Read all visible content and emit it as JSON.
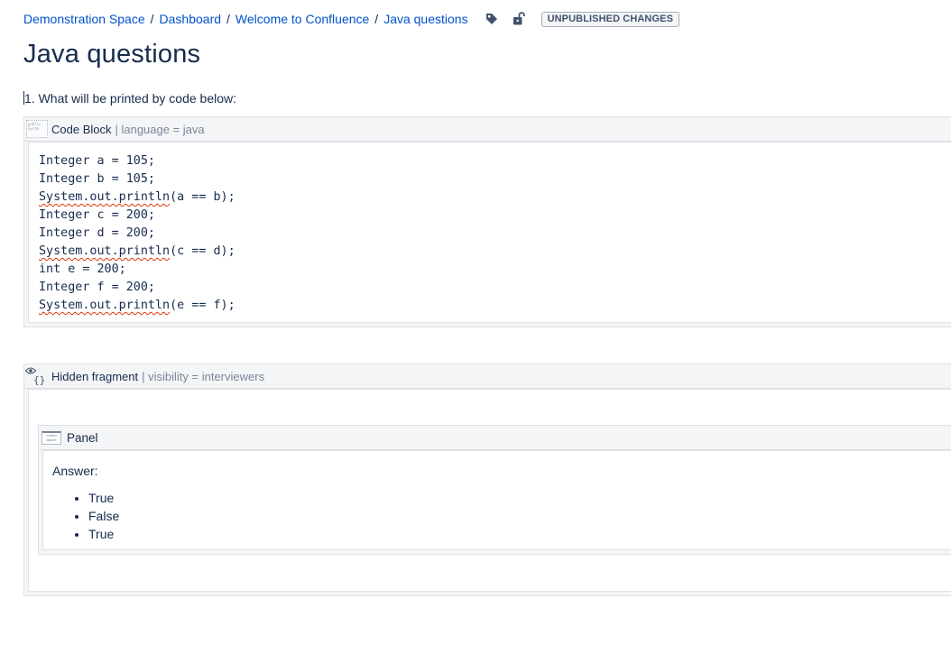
{
  "breadcrumb": {
    "items": [
      "Demonstration Space",
      "Dashboard",
      "Welcome to Confluence",
      "Java questions"
    ],
    "separator": "/",
    "status_badge": "UNPUBLISHED CHANGES"
  },
  "page": {
    "title": "Java questions",
    "question": "1. What will be printed by code below:"
  },
  "code_block": {
    "title": "Code Block",
    "param": "| language = java",
    "lines": [
      "Integer a = 105;",
      "Integer b = 105;",
      "System.out.println(a == b);",
      "Integer c = 200;",
      "Integer d = 200;",
      "System.out.println(c == d);",
      "int e = 200;",
      "Integer f = 200;",
      "System.out.println(e == f);"
    ],
    "misspelled_prefix": "System.out.println",
    "thumb_text": "public Syste"
  },
  "hidden_fragment": {
    "title": "Hidden fragment",
    "param": "| visibility = interviewers",
    "icon_text": "{}"
  },
  "panel": {
    "title": "Panel",
    "thumb_text": "Lorem Ipsum",
    "answer_label": "Answer:",
    "answers": [
      "True",
      "False",
      "True"
    ]
  },
  "icons": {
    "tag": "tag-icon",
    "lock": "unlocked-icon",
    "eye": "eye-icon"
  },
  "colors": {
    "link": "#0052cc",
    "text": "#172b4d",
    "muted": "#7a869a",
    "macro_bg": "#f4f5f7",
    "border": "#dfe1e6"
  }
}
